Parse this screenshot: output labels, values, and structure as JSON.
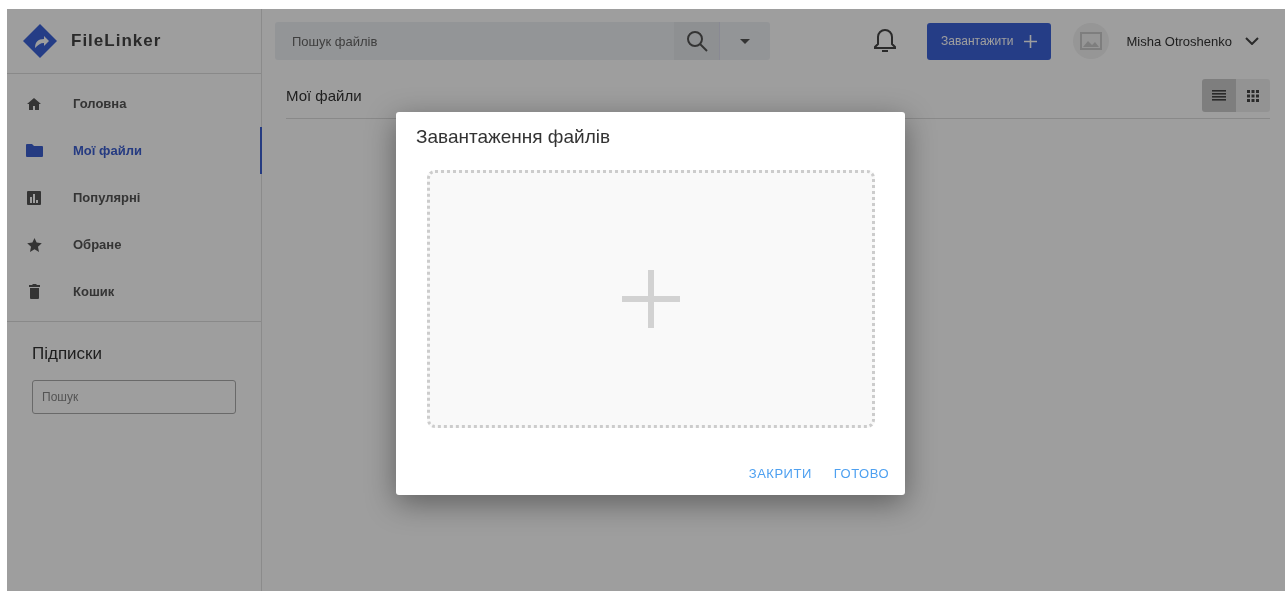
{
  "sidebar": {
    "logo": "FileLinker",
    "items": [
      {
        "label": "Головна",
        "kind": "home",
        "selected": false
      },
      {
        "label": "Мої файли",
        "kind": "folder",
        "selected": true
      },
      {
        "label": "Популярні",
        "kind": "chart",
        "selected": false
      },
      {
        "label": "Обране",
        "kind": "star",
        "selected": false
      },
      {
        "label": "Кошик",
        "kind": "trash",
        "selected": false
      }
    ],
    "subscriptions": {
      "title": "Підписки",
      "search": {
        "placeholder": "Пошук"
      }
    }
  },
  "topbar": {
    "search": {
      "placeholder": "Пошук файлів"
    },
    "upload_button": "Завантажити",
    "user": {
      "name": "Misha Otroshenko"
    }
  },
  "content": {
    "title": "Мої файли",
    "views": [
      {
        "kind": "list",
        "selected": true
      },
      {
        "kind": "grid",
        "selected": false
      }
    ]
  },
  "dialog": {
    "title": "Завантаження файлів",
    "buttons": [
      "ЗАКРИТИ",
      "ГОТОВО"
    ]
  }
}
